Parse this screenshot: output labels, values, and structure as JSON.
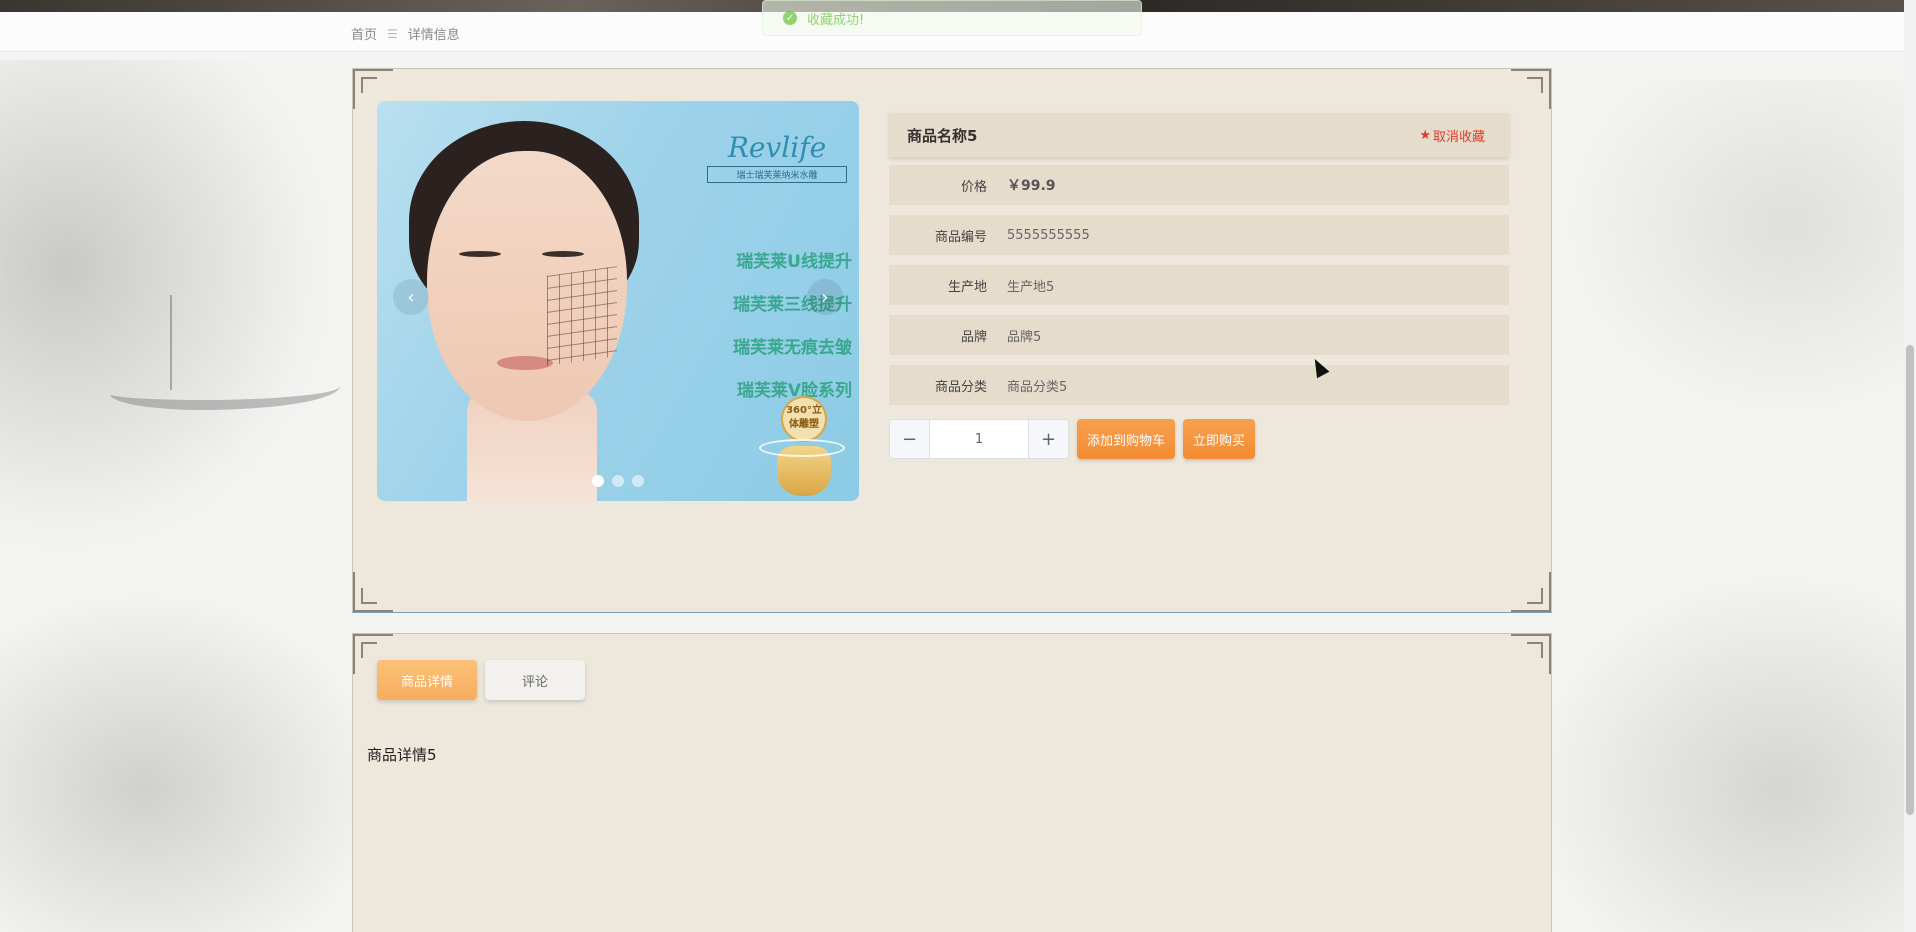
{
  "toast": {
    "message": "收藏成功!"
  },
  "breadcrumb": {
    "home": "首页",
    "separator": "☰",
    "current": "详情信息"
  },
  "product": {
    "name": "商品名称5",
    "favorite_label": "取消收藏",
    "rows": [
      {
        "label": "价格",
        "value": "￥99.9"
      },
      {
        "label": "商品编号",
        "value": "5555555555"
      },
      {
        "label": "生产地",
        "value": "生产地5"
      },
      {
        "label": "品牌",
        "value": "品牌5"
      },
      {
        "label": "商品分类",
        "value": "商品分类5"
      }
    ]
  },
  "carousel": {
    "brand": "Revlife",
    "brand_sub": "瑞士瑞芙莱纳米水雕",
    "slogans": [
      "瑞芙莱U线提升",
      "瑞芙莱三线提升",
      "瑞芙莱无痕去皱",
      "瑞芙莱V脸系列"
    ],
    "badge": "360°立体雕塑",
    "slide_count": 3,
    "active_index": 0
  },
  "quantity": {
    "value": "1",
    "minus": "−",
    "plus": "+"
  },
  "buttons": {
    "add_to_cart": "添加到购物车",
    "buy_now": "立即购买"
  },
  "tabs": {
    "detail": "商品详情",
    "comments": "评论"
  },
  "detail_content": "商品详情5",
  "colors": {
    "accent_orange": "#f7ad5c",
    "panel_bg": "#ede7dc",
    "fav_red": "#e23b2b"
  }
}
